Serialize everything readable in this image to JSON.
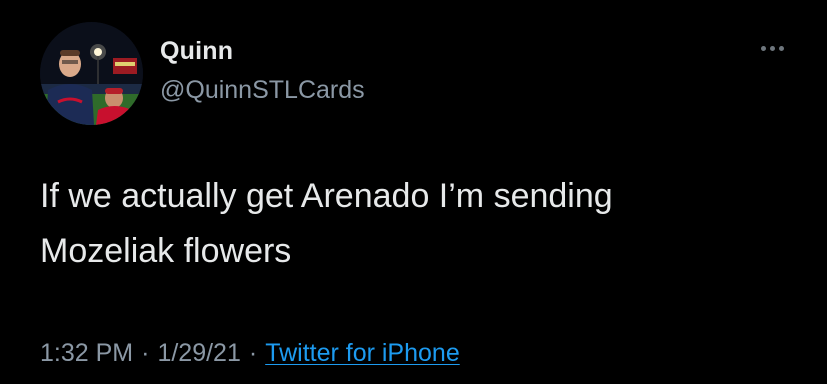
{
  "tweet": {
    "author": {
      "display_name": "Quinn",
      "handle": "@QuinnSTLCards"
    },
    "more_icon": "more-horizontal-icon",
    "text_lines": [
      "If we actually get Arenado I’m sending",
      "Mozeliak flowers"
    ],
    "meta": {
      "time": "1:32 PM",
      "separator": "·",
      "date": "1/29/21",
      "source": "Twitter for iPhone"
    }
  },
  "colors": {
    "background": "#000000",
    "primary_text": "#e7e9ea",
    "secondary_text": "#8b98a5",
    "link": "#1d9bf0"
  }
}
